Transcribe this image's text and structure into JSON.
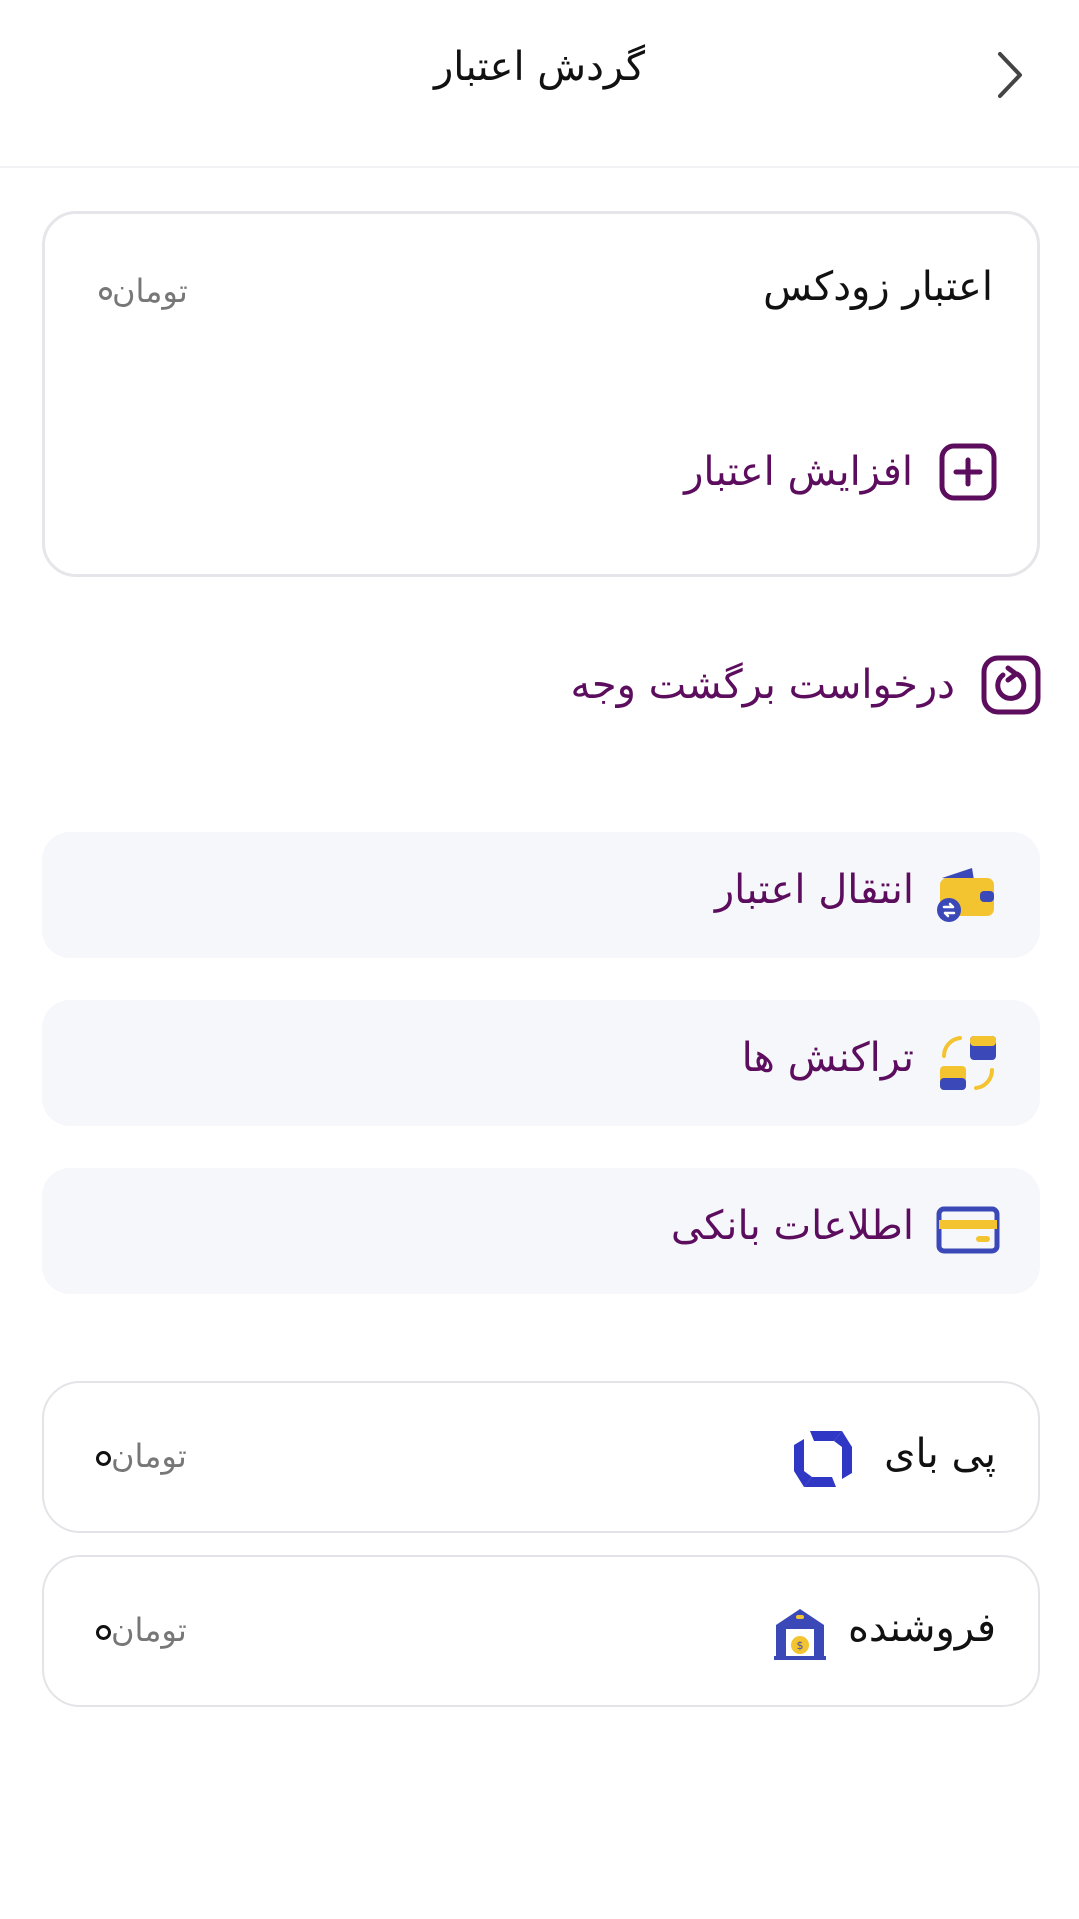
{
  "header": {
    "title": "گردش اعتبار"
  },
  "credit": {
    "label": "اعتبار زودکس",
    "currency": "تومان",
    "increase_label": "افزایش اعتبار"
  },
  "refund": {
    "label": "درخواست برگشت وجه"
  },
  "menu": [
    {
      "label": "انتقال اعتبار",
      "icon": "wallet-transfer-icon"
    },
    {
      "label": "تراکنش ها",
      "icon": "transactions-icon"
    },
    {
      "label": "اطلاعات بانکی",
      "icon": "bank-card-icon"
    }
  ],
  "balances": [
    {
      "label": "پی بای",
      "currency": "تومان",
      "icon": "paybuy-logo-icon"
    },
    {
      "label": "فروشنده",
      "currency": "تومان",
      "icon": "seller-store-icon"
    }
  ],
  "colors": {
    "accent": "#5c0d5e",
    "icon_blue": "#3b49b8",
    "icon_yellow": "#f4c430",
    "tile_bg": "#f6f7fa"
  }
}
